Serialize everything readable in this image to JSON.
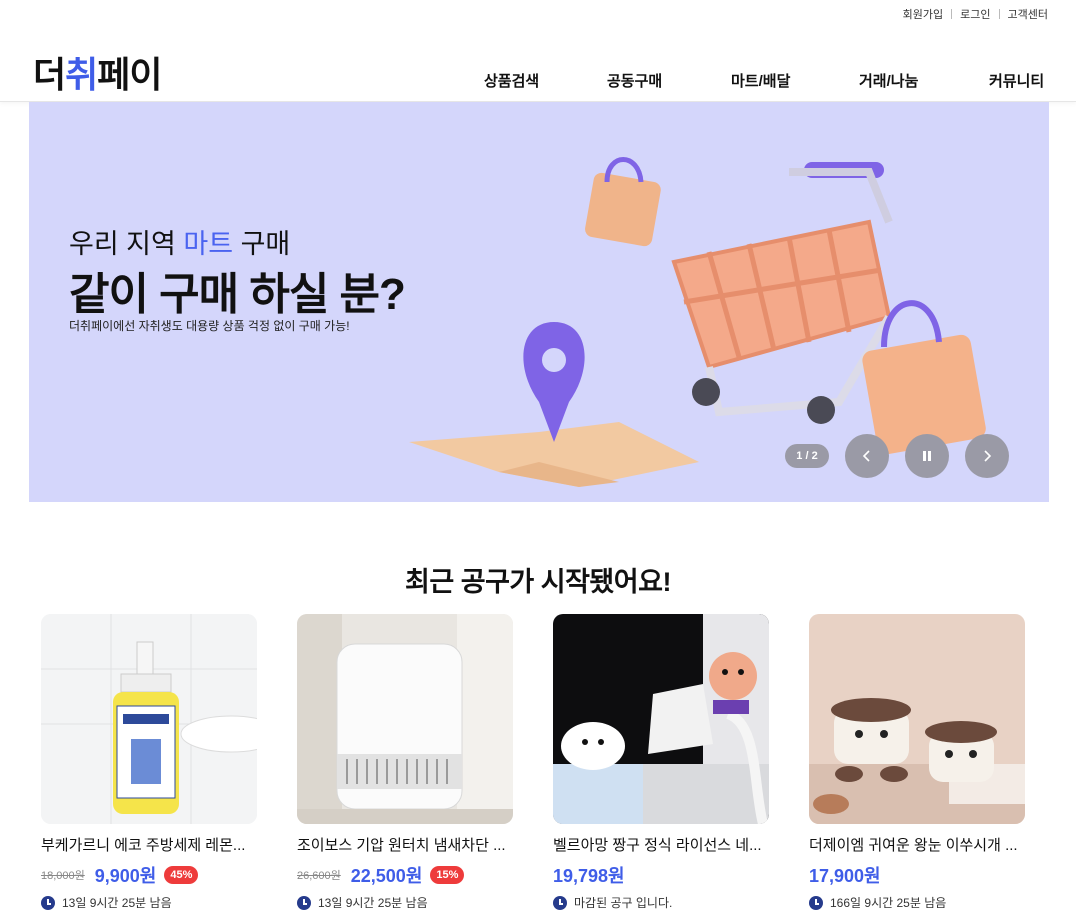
{
  "topbar": {
    "signup": "회원가입",
    "login": "로그인",
    "support": "고객센터"
  },
  "logo": {
    "part1": "더",
    "part2": "취",
    "part3": "페이"
  },
  "nav": [
    "상품검색",
    "공동구매",
    "마트/배달",
    "거래/나눔",
    "커뮤니티"
  ],
  "hero": {
    "sub_prefix": "우리 지역 ",
    "sub_highlight": "마트",
    "sub_suffix": " 구매",
    "title": "같이 구매 하실 분?",
    "desc": "더취페이에선 자취생도 대용량 상품 걱정 없이 구매 가능!",
    "pager": "1 / 2"
  },
  "section_title": "최근 공구가 시작됐어요!",
  "products": [
    {
      "name": "부케가르니 에코 주방세제 레몬...",
      "old_price": "18,000원",
      "price": "9,900원",
      "discount": "45%",
      "time": "13일 9시간 25분 남음"
    },
    {
      "name": "조이보스 기압 원터치 냄새차단 ...",
      "old_price": "26,600원",
      "price": "22,500원",
      "discount": "15%",
      "time": "13일 9시간 25분 남음"
    },
    {
      "name": "벨르아망 짱구 정식 라이선스 네...",
      "old_price": "",
      "price": "19,798원",
      "discount": "",
      "time": "마감된 공구 입니다."
    },
    {
      "name": "더제이엠 귀여운 왕눈 이쑤시개 ...",
      "old_price": "",
      "price": "17,900원",
      "discount": "",
      "time": "166일 9시간 25분 남음"
    }
  ],
  "colors": {
    "accent": "#3f5de8",
    "hero_bg": "#d4d6fb",
    "badge": "#ee3b3b"
  }
}
